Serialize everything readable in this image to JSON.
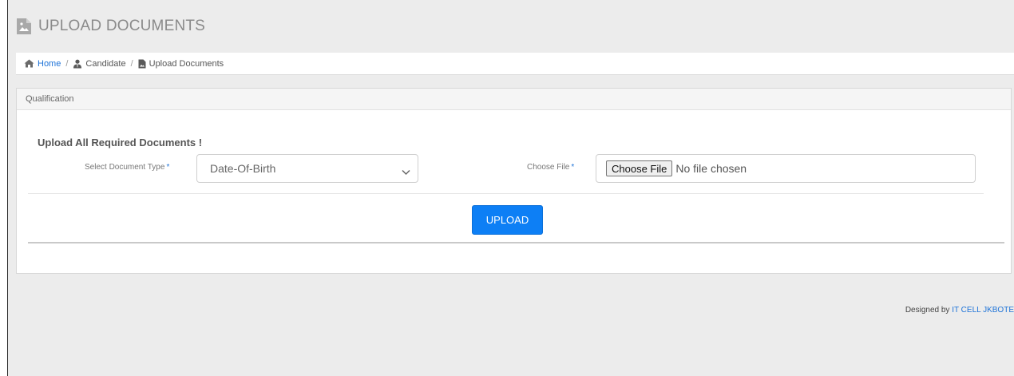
{
  "header": {
    "title": "UPLOAD DOCUMENTS",
    "icon": "image-file-icon"
  },
  "breadcrumb": {
    "home": "Home",
    "candidate": "Candidate",
    "current": "Upload Documents",
    "separator": "/"
  },
  "panel": {
    "heading": "Qualification",
    "form_title": "Upload All Required Documents !",
    "document_type": {
      "label": "Select Document Type",
      "required_marker": "*",
      "selected": "Date-Of-Birth"
    },
    "file": {
      "label": "Choose File",
      "required_marker": "*",
      "button_label": "Choose File",
      "status": "No file chosen"
    },
    "upload_label": "UPLOAD"
  },
  "footer": {
    "prefix": "Designed by",
    "link": "IT CELL JKBOTE"
  },
  "colors": {
    "accent": "#0d7ff5",
    "link": "#1e73d8",
    "page_bg": "#ececec"
  }
}
